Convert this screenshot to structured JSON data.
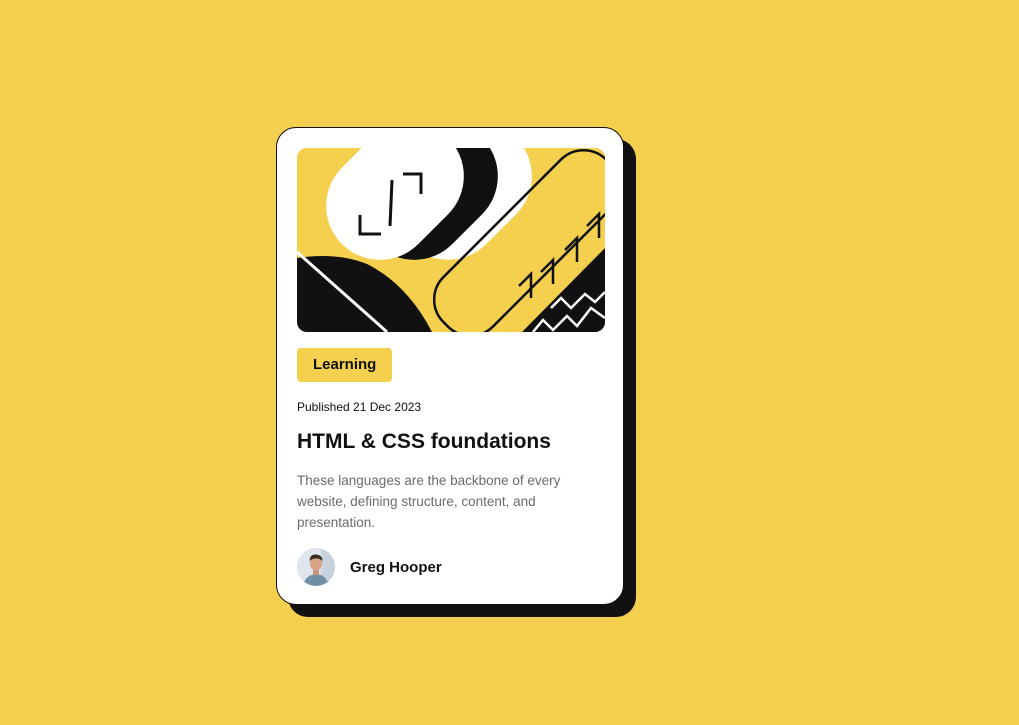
{
  "colors": {
    "page_background": "#F4D04E",
    "card_background": "#FFFFFF",
    "ink": "#111111",
    "accent": "#F4D04E",
    "muted_text": "#6B6B6B"
  },
  "card": {
    "illustration": "abstract-geometric-illustration",
    "category_label": "Learning",
    "published": "Published 21 Dec 2023",
    "title": "HTML & CSS foundations",
    "description": "These languages are the backbone of every website, defining structure, content, and presentation.",
    "author": {
      "name": "Greg Hooper",
      "avatar": "author-avatar"
    }
  }
}
